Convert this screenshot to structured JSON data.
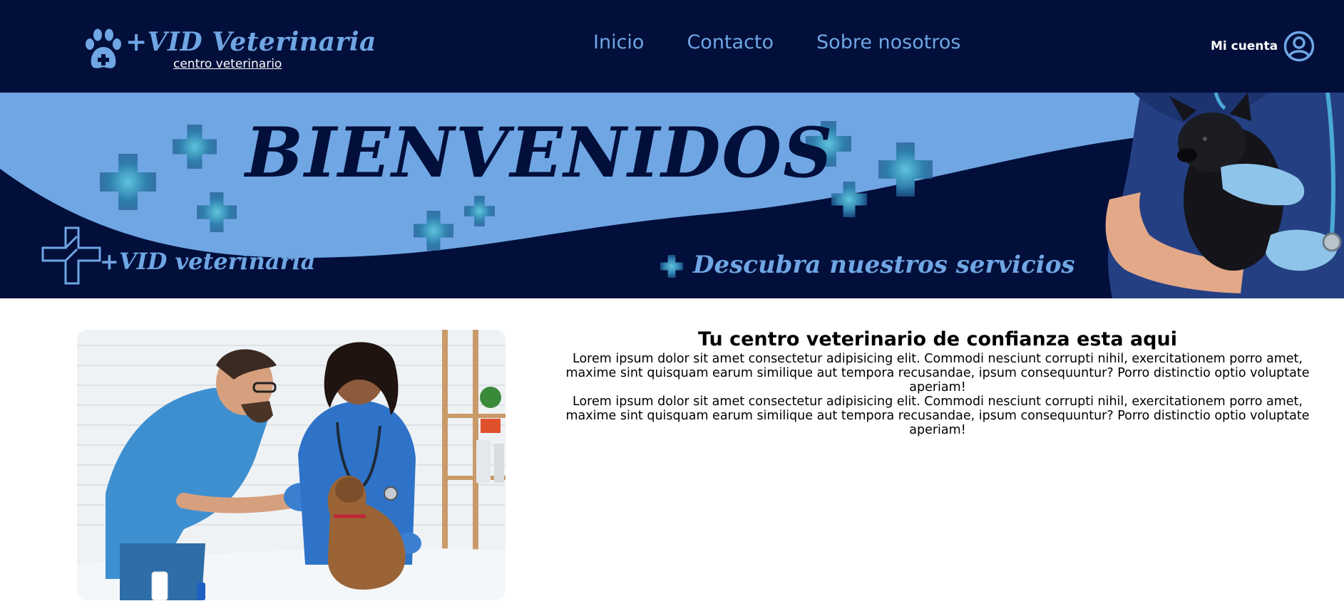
{
  "header": {
    "brand": "+VID Veterinaria",
    "subtitle": "centro veterinario",
    "nav": [
      "Inicio",
      "Contacto",
      "Sobre nosotros"
    ],
    "account_label": "Mi cuenta",
    "icons": {
      "logo": "paw-icon",
      "account": "user-circle-icon"
    }
  },
  "hero": {
    "title": "BIENVENIDOS",
    "brand": "+VID veterinaria",
    "cta": "Descubra nuestros servicios",
    "icons": {
      "logo": "medical-cross-icon"
    }
  },
  "content": {
    "title": "Tu centro veterinario de confianza esta aqui",
    "paragraphs": [
      "Lorem ipsum dolor sit amet consectetur adipisicing elit. Commodi nesciunt corrupti nihil, exercitationem porro amet, maxime sint quisquam earum similique aut tempora recusandae, ipsum consequuntur? Porro distinctio optio voluptate aperiam!",
      "Lorem ipsum dolor sit amet consectetur adipisicing elit. Commodi nesciunt corrupti nihil, exercitationem porro amet, maxime sint quisquam earum similique aut tempora recusandae, ipsum consequuntur? Porro distinctio optio voluptate aperiam!"
    ]
  },
  "colors": {
    "navy": "#020f3b",
    "accent_blue": "#6fa6e3",
    "cross_teal": "#2f8fb8",
    "scrubs_blue": "#2a6fc9",
    "text": "#000000"
  }
}
